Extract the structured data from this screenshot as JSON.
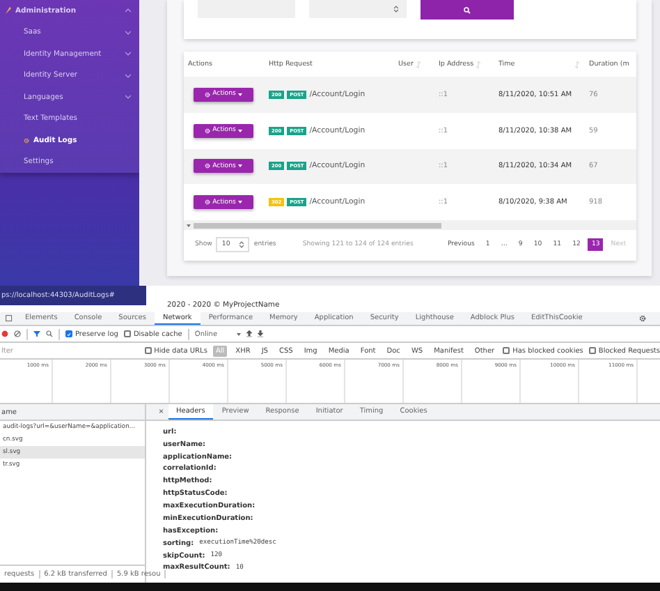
{
  "sidebar": {
    "items": [
      {
        "label": "Administration",
        "selected": false,
        "kind": "group",
        "expanded": true
      },
      {
        "label": "Saas",
        "selected": false,
        "kind": "group",
        "expanded": false
      },
      {
        "label": "Identity Management",
        "selected": false,
        "kind": "group",
        "expanded": false
      },
      {
        "label": "Identity Server",
        "selected": false,
        "kind": "group",
        "expanded": false
      },
      {
        "label": "Languages",
        "selected": false,
        "kind": "group",
        "expanded": false
      },
      {
        "label": "Text Templates",
        "selected": false,
        "kind": "link"
      },
      {
        "label": "Audit Logs",
        "selected": true,
        "kind": "link"
      },
      {
        "label": "Settings",
        "selected": false,
        "kind": "link"
      }
    ]
  },
  "table": {
    "columns": [
      {
        "label": "Actions",
        "sortable": false
      },
      {
        "label": "Http Request",
        "sortable": false
      },
      {
        "label": "User",
        "sortable": true
      },
      {
        "label": "Ip Address",
        "sortable": true
      },
      {
        "label": "Time",
        "sortable": true
      },
      {
        "label": "Duration (m",
        "sortable": false
      }
    ],
    "rows": [
      {
        "action": "Actions",
        "status": "200",
        "color": "#1aa38a",
        "method": "POST",
        "url": "/Account/Login",
        "ip": "::1",
        "time": "8/11/2020, 10:51 AM",
        "duration": "76"
      },
      {
        "action": "Actions",
        "status": "200",
        "color": "#1aa38a",
        "method": "POST",
        "url": "/Account/Login",
        "ip": "::1",
        "time": "8/11/2020, 10:38 AM",
        "duration": "59"
      },
      {
        "action": "Actions",
        "status": "200",
        "color": "#1aa38a",
        "method": "POST",
        "url": "/Account/Login",
        "ip": "::1",
        "time": "8/11/2020, 10:34 AM",
        "duration": "67"
      },
      {
        "action": "Actions",
        "status": "302",
        "color": "#f2c40f",
        "method": "POST",
        "url": "/Account/Login",
        "ip": "::1",
        "time": "8/10/2020, 9:38 AM",
        "duration": "918"
      }
    ]
  },
  "pagination": {
    "show": "Show",
    "page_size": "10",
    "entries": "entries",
    "info": "Showing 121 to 124 of 124 entries",
    "previous": {
      "label": "Previous",
      "disabled": false
    },
    "pages": [
      {
        "label": "1",
        "selected": false
      },
      {
        "label": "…",
        "selected": false
      },
      {
        "label": "9",
        "selected": false
      },
      {
        "label": "10",
        "selected": false
      },
      {
        "label": "11",
        "selected": false
      },
      {
        "label": "12",
        "selected": false
      },
      {
        "label": "13",
        "selected": true
      }
    ],
    "next": {
      "label": "Next",
      "disabled": true
    }
  },
  "status_url": "ps://localhost:44303/AuditLogs#",
  "footer": "2020 - 2020 © MyProjectName",
  "devtools": {
    "tabs": [
      {
        "label": "Elements",
        "selected": false
      },
      {
        "label": "Console",
        "selected": false
      },
      {
        "label": "Sources",
        "selected": false
      },
      {
        "label": "Network",
        "selected": true
      },
      {
        "label": "Performance",
        "selected": false
      },
      {
        "label": "Memory",
        "selected": false
      },
      {
        "label": "Application",
        "selected": false
      },
      {
        "label": "Security",
        "selected": false
      },
      {
        "label": "Lighthouse",
        "selected": false
      },
      {
        "label": "Adblock Plus",
        "selected": false
      },
      {
        "label": "EditThisCookie",
        "selected": false
      }
    ],
    "preserve_log": {
      "label": "Preserve log",
      "checked": true
    },
    "disable_cache": {
      "label": "Disable cache",
      "checked": false
    },
    "throttling": "Online",
    "filter_placeholder": "lter",
    "hide_data_urls": {
      "label": "Hide data URLs",
      "checked": false
    },
    "type_filters": [
      {
        "label": "All",
        "selected": true
      },
      {
        "label": "XHR",
        "selected": false
      },
      {
        "label": "JS",
        "selected": false
      },
      {
        "label": "CSS",
        "selected": false
      },
      {
        "label": "Img",
        "selected": false
      },
      {
        "label": "Media",
        "selected": false
      },
      {
        "label": "Font",
        "selected": false
      },
      {
        "label": "Doc",
        "selected": false
      },
      {
        "label": "WS",
        "selected": false
      },
      {
        "label": "Manifest",
        "selected": false
      },
      {
        "label": "Other",
        "selected": false
      }
    ],
    "blocked_cookies": {
      "label": "Has blocked cookies",
      "checked": false
    },
    "blocked_requests": {
      "label": "Blocked Requests",
      "checked": false
    },
    "timeline_ticks": [
      "1000 ms",
      "2000 ms",
      "3000 ms",
      "4000 ms",
      "5000 ms",
      "6000 ms",
      "7000 ms",
      "8000 ms",
      "9000 ms",
      "10000 ms",
      "11000 ms"
    ],
    "name_header": "ame",
    "requests": [
      {
        "name": "audit-logs?url=&userName=&application...",
        "selected": false
      },
      {
        "name": "cn.svg",
        "selected": false
      },
      {
        "name": "sl.svg",
        "selected": true
      },
      {
        "name": "tr.svg",
        "selected": false
      }
    ],
    "close": "×",
    "detail_tabs": [
      {
        "label": "Headers",
        "selected": true
      },
      {
        "label": "Preview",
        "selected": false
      },
      {
        "label": "Response",
        "selected": false
      },
      {
        "label": "Initiator",
        "selected": false
      },
      {
        "label": "Timing",
        "selected": false
      },
      {
        "label": "Cookies",
        "selected": false
      }
    ],
    "params": [
      {
        "key": "url:"
      },
      {
        "key": "userName:"
      },
      {
        "key": "applicationName:"
      },
      {
        "key": "correlationId:"
      },
      {
        "key": "httpMethod:"
      },
      {
        "key": "httpStatusCode:"
      },
      {
        "key": "maxExecutionDuration:"
      },
      {
        "key": "minExecutionDuration:"
      },
      {
        "key": "hasException:"
      },
      {
        "key": "sorting:",
        "value": "executionTime%20desc"
      },
      {
        "key": "skipCount:",
        "value": "120"
      },
      {
        "key": "maxResultCount:",
        "value": "10"
      }
    ],
    "status_bar": [
      "requests",
      "6.2 kB transferred",
      "5.9 kB resou"
    ]
  }
}
